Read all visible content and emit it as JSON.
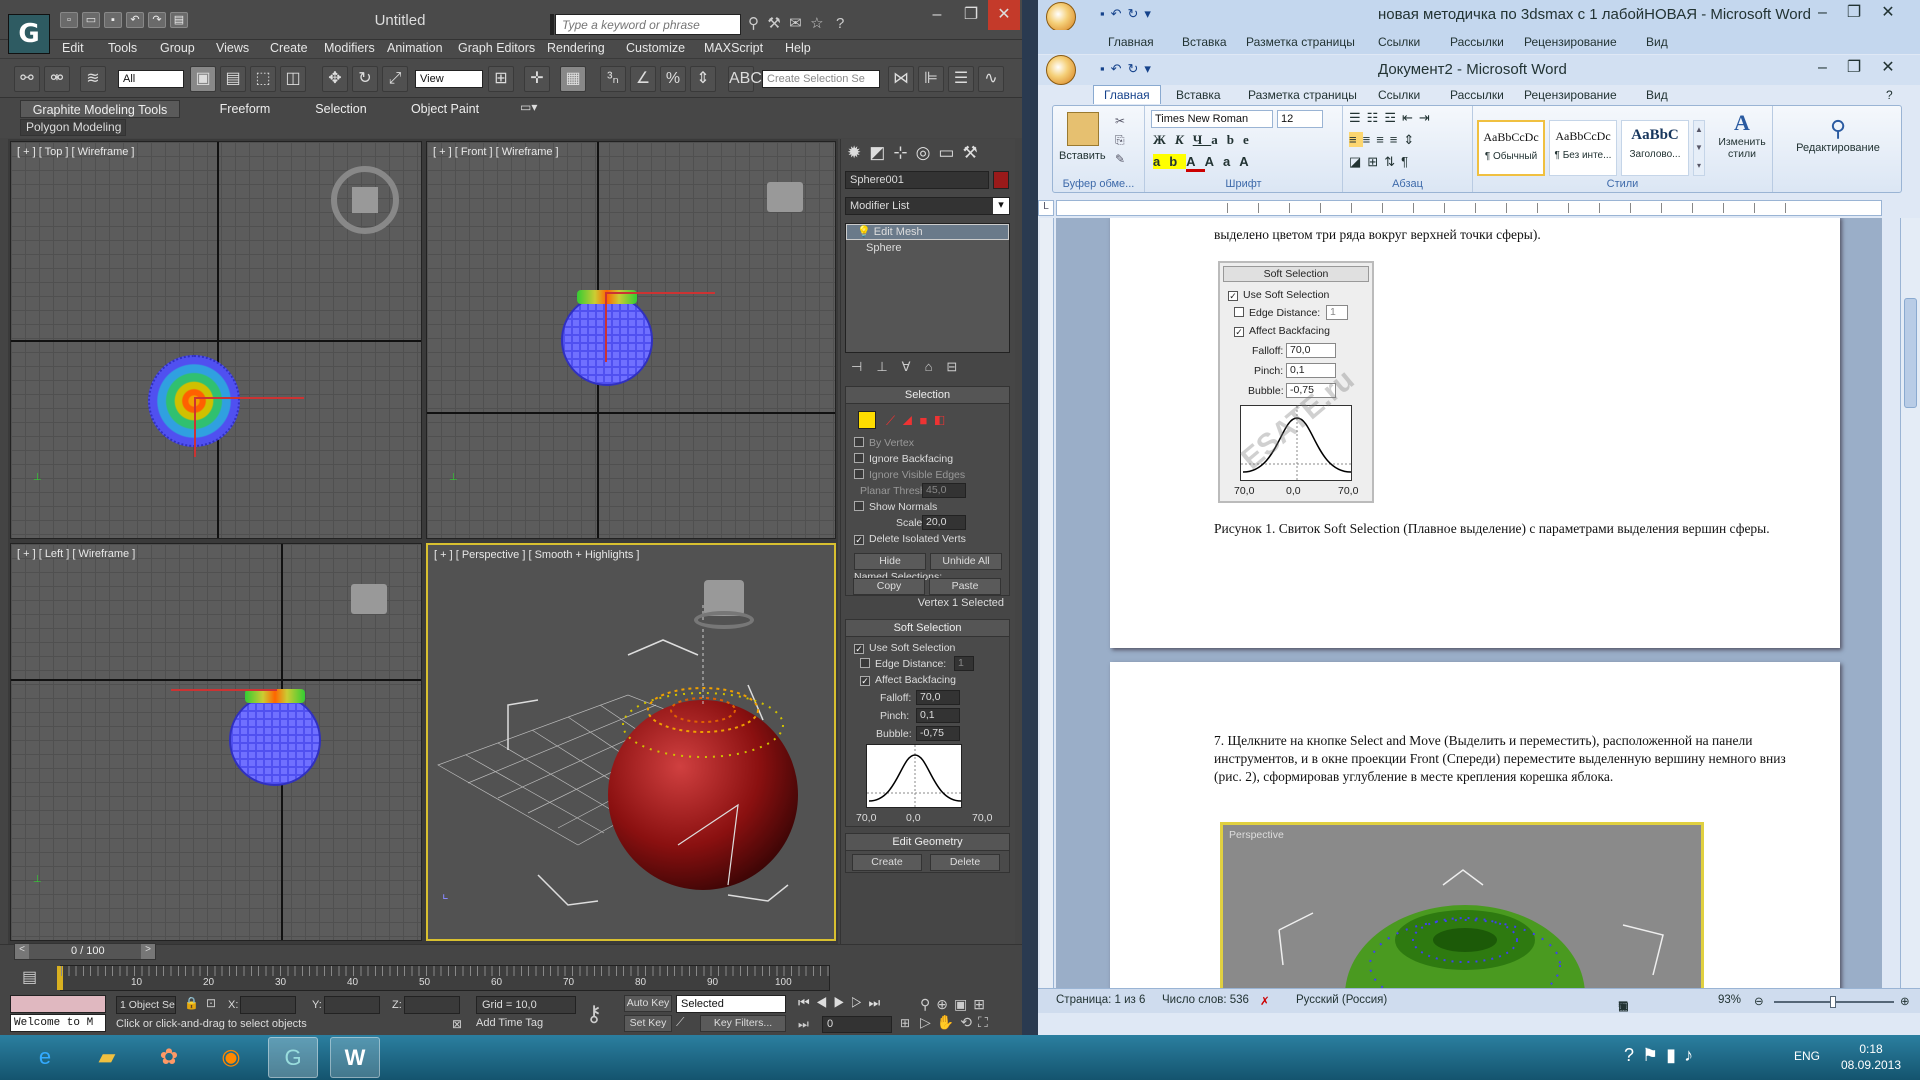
{
  "max": {
    "title": "Untitled",
    "search_placeholder": "Type a keyword or phrase",
    "menu": [
      "Edit",
      "Tools",
      "Group",
      "Views",
      "Create",
      "Modifiers",
      "Animation",
      "Graph Editors",
      "Rendering",
      "Customize",
      "MAXScript",
      "Help"
    ],
    "filter_value": "All",
    "refcoord_value": "View",
    "named_sel_placeholder": "Create Selection Se",
    "ribbon_tabs": [
      "Graphite Modeling Tools",
      "Freeform",
      "Selection",
      "Object Paint"
    ],
    "ribbon_sub": "Polygon Modeling",
    "viewports": {
      "top": "[ + ] [ Top ] [ Wireframe ]",
      "front": "[ + ] [ Front ] [ Wireframe ]",
      "left": "[ + ] [ Left ] [ Wireframe ]",
      "persp": "[ + ] [ Perspective ] [ Smooth + Highlights ]"
    },
    "cmd": {
      "object_name": "Sphere001",
      "modifier_list": "Modifier List",
      "stack": [
        "Edit Mesh",
        "Sphere"
      ],
      "selection": {
        "title": "Selection",
        "by_vertex": "By Vertex",
        "ignore_backfacing": "Ignore Backfacing",
        "ignore_visible_edges": "Ignore Visible Edges",
        "planar_thresh_label": "Planar Thresh:",
        "planar_thresh": "45,0",
        "show_normals": "Show Normals",
        "scale_label": "Scale:",
        "scale": "20,0",
        "delete_isolated": "Delete Isolated Verts",
        "hide": "Hide",
        "unhide_all": "Unhide All",
        "named_selections": "Named Selections:",
        "copy": "Copy",
        "paste": "Paste",
        "status": "Vertex 1 Selected"
      },
      "soft": {
        "title": "Soft Selection",
        "use_soft": "Use Soft Selection",
        "edge_distance": "Edge Distance:",
        "edge_distance_val": "1",
        "affect_backfacing": "Affect Backfacing",
        "falloff_label": "Falloff:",
        "falloff": "70,0",
        "pinch_label": "Pinch:",
        "pinch": "0,1",
        "bubble_label": "Bubble:",
        "bubble": "-0,75",
        "curve_left": "70,0",
        "curve_mid": "0,0",
        "curve_right": "70,0"
      },
      "edit_geometry": {
        "title": "Edit Geometry",
        "create": "Create",
        "delete": "Delete"
      }
    },
    "timeline": {
      "frame": "0 / 100",
      "ticks": [
        "10",
        "20",
        "30",
        "40",
        "50",
        "60",
        "70",
        "80",
        "90",
        "100"
      ]
    },
    "status": {
      "maxscript": "Welcome to M",
      "objects": "1 Object Se",
      "x_label": "X:",
      "y_label": "Y:",
      "z_label": "Z:",
      "grid": "Grid = 10,0",
      "prompt": "Click or click-and-drag to select objects",
      "add_time_tag": "Add Time Tag",
      "auto_key": "Auto Key",
      "selected": "Selected",
      "set_key": "Set Key",
      "key_filters": "Key Filters...",
      "frame_field": "0"
    }
  },
  "word": {
    "title_back": "новая методичка по 3dsmax с 1 лабойНОВАЯ - Microsoft Word",
    "title_front": "Документ2 - Microsoft Word",
    "tabs": [
      "Главная",
      "Вставка",
      "Разметка страницы",
      "Ссылки",
      "Рассылки",
      "Рецензирование",
      "Вид"
    ],
    "ribbon": {
      "paste": "Вставить",
      "clipboard": "Буфер обме...",
      "font_name": "Times New Roman",
      "font_size": "12",
      "font_group": "Шрифт",
      "para_group": "Абзац",
      "styles_group": "Стили",
      "styles": [
        {
          "sample": "AaBbCcDc",
          "name": "¶ Обычный"
        },
        {
          "sample": "AaBbCcDc",
          "name": "¶ Без инте..."
        },
        {
          "sample": "AaBbC",
          "name": "Заголово..."
        }
      ],
      "change_styles": "Изменить стили",
      "editing": "Редактирование"
    },
    "page1": {
      "top_text": "выделено цветом три ряда вокруг верхней точки сферы).",
      "fig": {
        "title": "Soft Selection",
        "use_soft": "Use Soft Selection",
        "edge_distance": "Edge Distance:",
        "edge_val": "1",
        "affect_backfacing": "Affect Backfacing",
        "falloff_label": "Falloff:",
        "falloff": "70,0",
        "pinch_label": "Pinch:",
        "pinch": "0,1",
        "bubble_label": "Bubble:",
        "bubble": "-0,75",
        "left": "70,0",
        "mid": "0,0",
        "right": "70,0",
        "watermark": "ESATE.ru"
      },
      "caption": "Рисунок 1. Свиток Soft Selection (Плавное выделение) с параметрами выделения вершин сферы."
    },
    "page2": {
      "para": "7. Щелкните на кнопке Select and Move (Выделить и переместить), расположенной на панели инструментов, и в окне проекции Front (Спереди) переместите выделенную вершину немного вниз (рис. 2), сформировав углубление в месте крепления корешка яблока.",
      "fig_label": "Perspective"
    },
    "status": {
      "page": "Страница: 1 из 6",
      "words": "Число слов: 536",
      "lang": "Русский (Россия)",
      "zoom": "93%"
    }
  },
  "taskbar": {
    "lang": "ENG",
    "time": "0:18",
    "date": "08.09.2013"
  }
}
